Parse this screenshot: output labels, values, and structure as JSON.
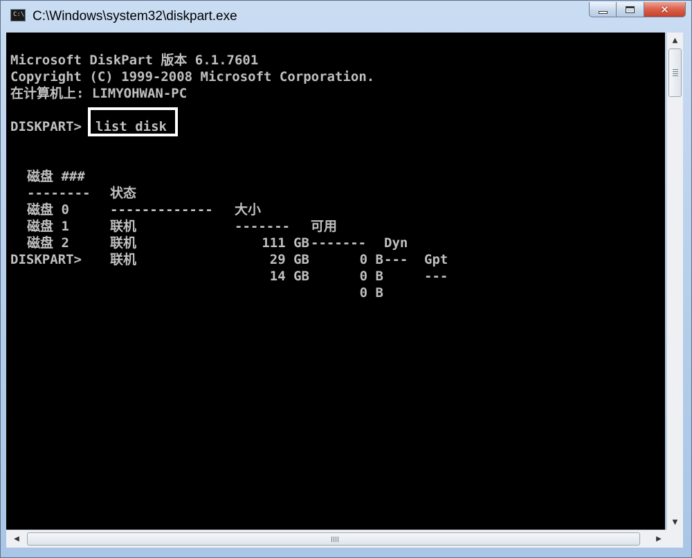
{
  "window": {
    "title": "C:\\Windows\\system32\\diskpart.exe",
    "buttons": {
      "minimize": "minimize",
      "maximize": "maximize",
      "close": "close"
    }
  },
  "console": {
    "banner_line1": "Microsoft DiskPart 版本 6.1.7601",
    "banner_line2": "Copyright (C) 1999-2008 Microsoft Corporation.",
    "banner_line3": "在计算机上: LIMYOHWAN-PC",
    "prompt": "DISKPART>",
    "command": "list disk",
    "table": {
      "headers": [
        "磁盘 ###",
        "状态",
        "大小",
        "可用",
        "Dyn",
        "Gpt"
      ],
      "separators": [
        "--------",
        "-------------",
        "-------",
        "-------",
        "---",
        "---"
      ],
      "rows": [
        [
          "磁盘 0",
          "联机",
          "111 GB",
          "0 B",
          "",
          ""
        ],
        [
          "磁盘 1",
          "联机",
          "29 GB",
          "0 B",
          "",
          ""
        ],
        [
          "磁盘 2",
          "联机",
          "14 GB",
          "0 B",
          "",
          ""
        ]
      ]
    },
    "prompt2": "DISKPART>"
  },
  "colors": {
    "console_bg": "#000000",
    "console_text": "#c0c0c0",
    "highlight_box": "#ffffff",
    "close_button": "#c6402a"
  }
}
